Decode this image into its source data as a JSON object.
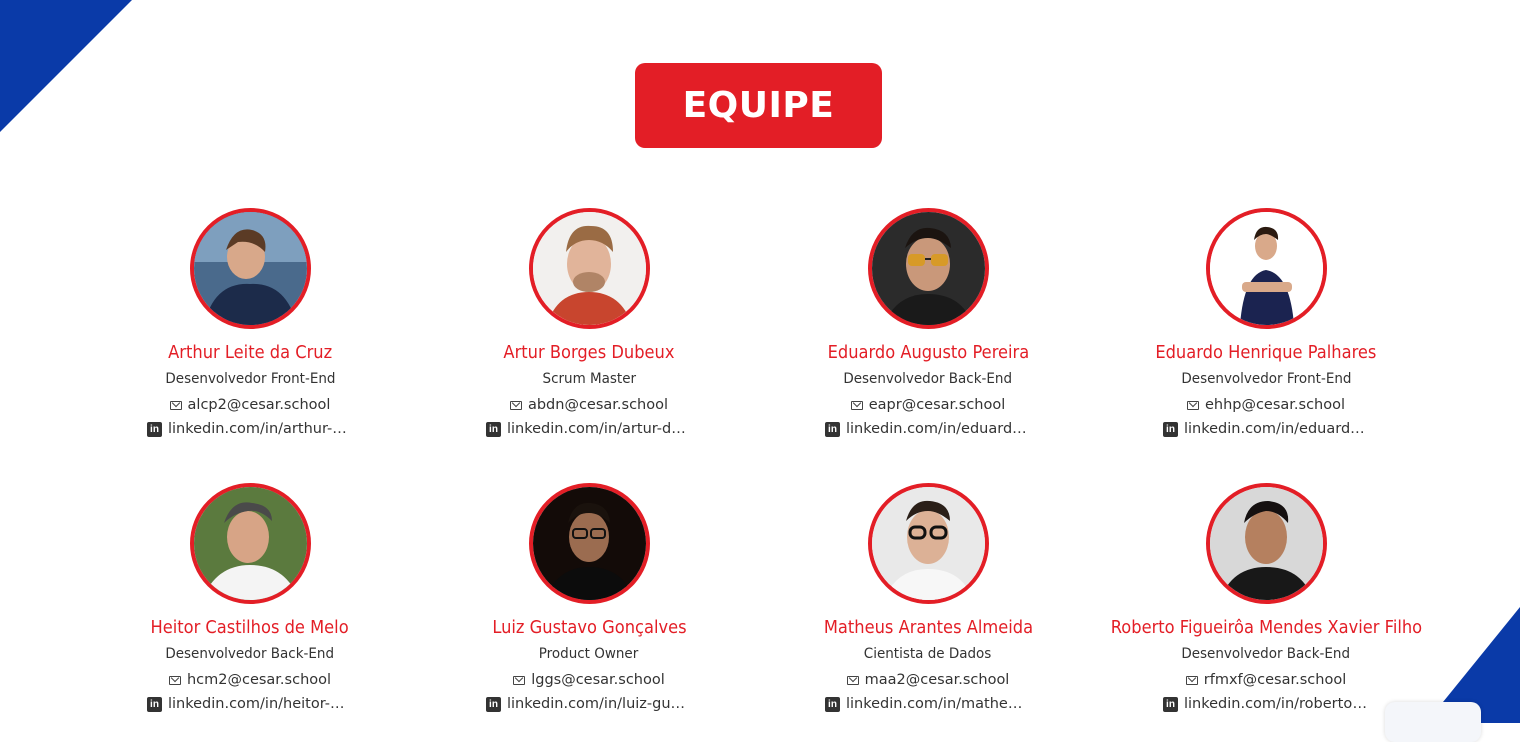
{
  "section_title": "EQUIPE",
  "colors": {
    "accent": "#e31e26",
    "corner": "#0a3aa8"
  },
  "members": [
    {
      "name": "Arthur Leite da Cruz",
      "role": "Desenvolvedor Front-End",
      "email": "alcp2@cesar.school",
      "linkedin": "linkedin.com/in/arthur-cruz"
    },
    {
      "name": "Artur Borges Dubeux",
      "role": "Scrum Master",
      "email": "abdn@cesar.school",
      "linkedin": "linkedin.com/in/artur-dub..."
    },
    {
      "name": "Eduardo Augusto Pereira",
      "role": "Desenvolvedor Back-End",
      "email": "eapr@cesar.school",
      "linkedin": "linkedin.com/in/eduardo-..."
    },
    {
      "name": "Eduardo Henrique Palhares",
      "role": "Desenvolvedor Front-End",
      "email": "ehhp@cesar.school",
      "linkedin": "linkedin.com/in/eduardo-..."
    },
    {
      "name": "Heitor Castilhos de Melo",
      "role": "Desenvolvedor Back-End",
      "email": "hcm2@cesar.school",
      "linkedin": "linkedin.com/in/heitor-melo"
    },
    {
      "name": "Luiz Gustavo Gonçalves",
      "role": "Product Owner",
      "email": "lggs@cesar.school",
      "linkedin": "linkedin.com/in/luiz-gusta..."
    },
    {
      "name": "Matheus Arantes Almeida",
      "role": "Cientista de Dados",
      "email": "maa2@cesar.school",
      "linkedin": "linkedin.com/in/matheus-..."
    },
    {
      "name": "Roberto Figueirôa Mendes Xavier Filho",
      "role": "Desenvolvedor Back-End",
      "email": "rfmxf@cesar.school",
      "linkedin": "linkedin.com/in/roberto-x..."
    }
  ],
  "icons": {
    "email": "mail-icon",
    "linkedin": "linkedin-icon"
  }
}
